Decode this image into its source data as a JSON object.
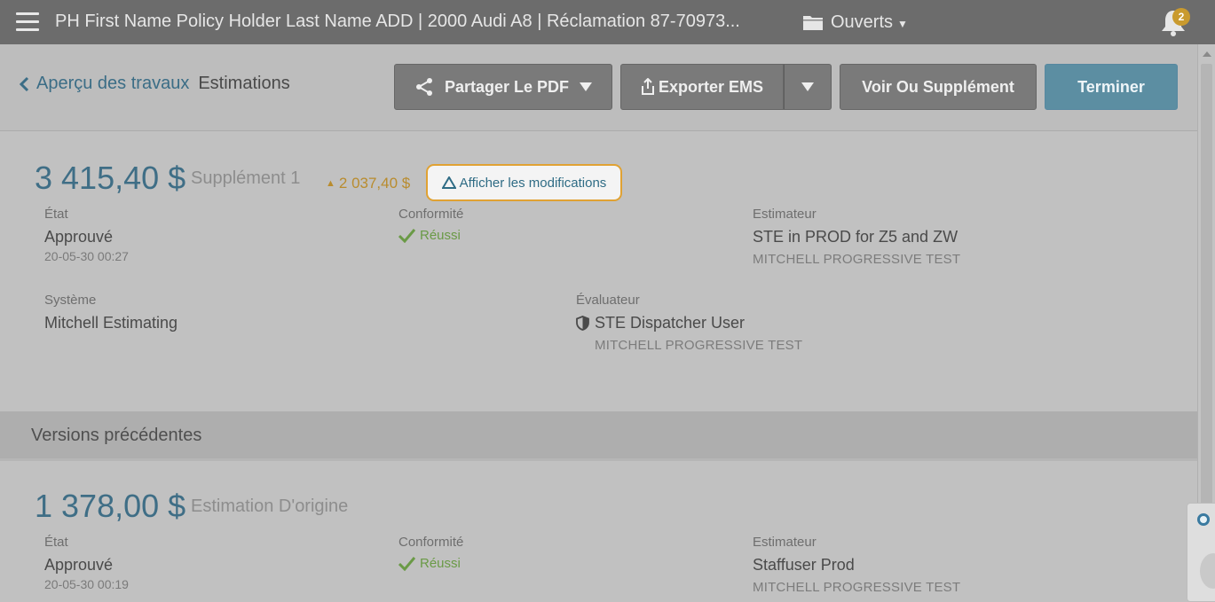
{
  "topbar": {
    "title": "PH First Name Policy Holder Last Name ADD | 2000 Audi A8 | Réclamation 87-70973...",
    "folder_label": "Ouverts",
    "notifications_count": "2",
    "icons": [
      "hamburger-menu-icon",
      "folder-icon",
      "chevron-down-icon",
      "bell-icon"
    ]
  },
  "breadcrumb": {
    "back_label": "Aperçu des travaux",
    "current_label": "Estimations"
  },
  "toolbar": {
    "share_label": "Partager Le PDF",
    "export_label": "Exporter EMS",
    "supplement_label": "Voir Ou Supplément",
    "finish_label": "Terminer"
  },
  "current_estimate": {
    "amount": "3 415,40 $",
    "label": "Supplément 1",
    "delta": "2 037,40 $",
    "show_changes_label": "Afficher les modifications",
    "state_label": "État",
    "state_value": "Approuvé",
    "state_date": "20-05-30 00:27",
    "compliance_label": "Conformité",
    "compliance_value": "Réussi",
    "estimator_label": "Estimateur",
    "estimator_name": "STE in PROD for Z5 and ZW",
    "estimator_company": "MITCHELL PROGRESSIVE TEST",
    "system_label": "Système",
    "system_value": "Mitchell Estimating",
    "appraiser_label": "Évaluateur",
    "appraiser_name": "STE Dispatcher User",
    "appraiser_company": "MITCHELL PROGRESSIVE TEST"
  },
  "previous_versions": {
    "title": "Versions précédentes"
  },
  "original_estimate": {
    "amount": "1 378,00 $",
    "label": "Estimation D'origine",
    "state_label": "État",
    "state_value": "Approuvé",
    "state_date": "20-05-30 00:19",
    "compliance_label": "Conformité",
    "compliance_value": "Réussi",
    "estimator_label": "Estimateur",
    "estimator_name": "Staffuser Prod",
    "estimator_company": "MITCHELL PROGRESSIVE TEST"
  },
  "colors": {
    "accent": "#3f6e86",
    "finish_button": "#5c8ea2",
    "badge": "#c99a2e",
    "success": "#6a9a46",
    "highlight_border": "#e0a233"
  }
}
